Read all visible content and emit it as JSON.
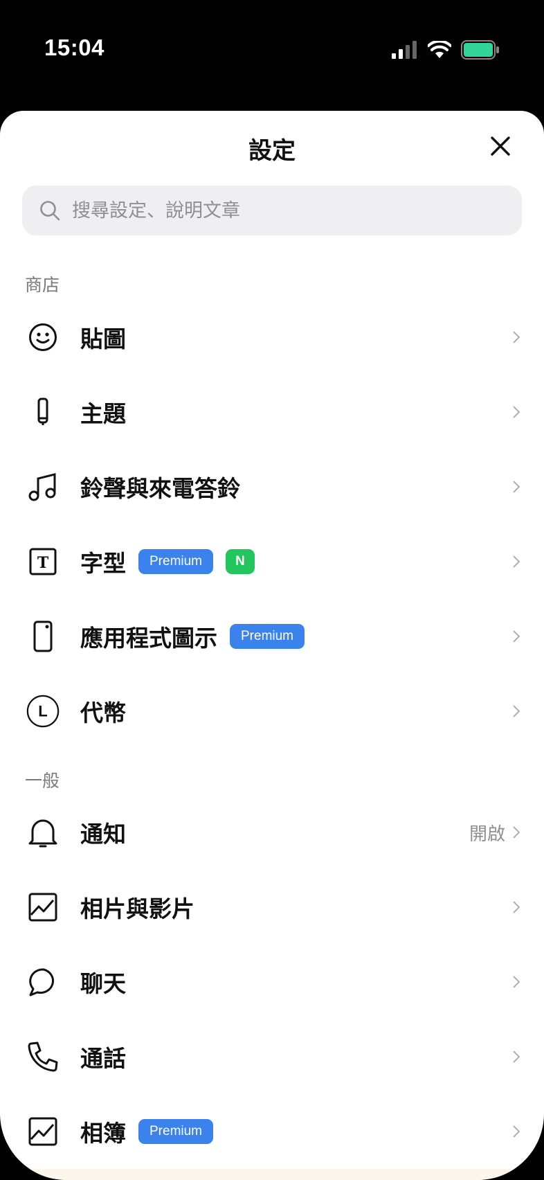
{
  "status": {
    "time": "15:04",
    "battery_color": "#34d399"
  },
  "sheet": {
    "title": "設定"
  },
  "search": {
    "placeholder": "搜尋設定、說明文章"
  },
  "sections": {
    "store_label": "商店",
    "general_label": "一般"
  },
  "store_items": [
    {
      "label": "貼圖",
      "icon": "smiley-icon"
    },
    {
      "label": "主題",
      "icon": "theme-icon"
    },
    {
      "label": "鈴聲與來電答鈴",
      "icon": "music-note-icon"
    },
    {
      "label": "字型",
      "icon": "font-icon",
      "badges": [
        "Premium",
        "N"
      ]
    },
    {
      "label": "應用程式圖示",
      "icon": "phone-icon",
      "badges": [
        "Premium"
      ]
    },
    {
      "label": "代幣",
      "icon": "coin-icon",
      "icon_letter": "L"
    }
  ],
  "general_items": [
    {
      "label": "通知",
      "icon": "bell-icon",
      "value": "開啟"
    },
    {
      "label": "相片與影片",
      "icon": "photo-icon"
    },
    {
      "label": "聊天",
      "icon": "chat-bubble-icon"
    },
    {
      "label": "通話",
      "icon": "phone-call-icon"
    },
    {
      "label": "相簿",
      "icon": "album-icon",
      "badges": [
        "Premium"
      ]
    }
  ],
  "colors": {
    "premium": "#3b82ec",
    "new": "#22c55e"
  }
}
